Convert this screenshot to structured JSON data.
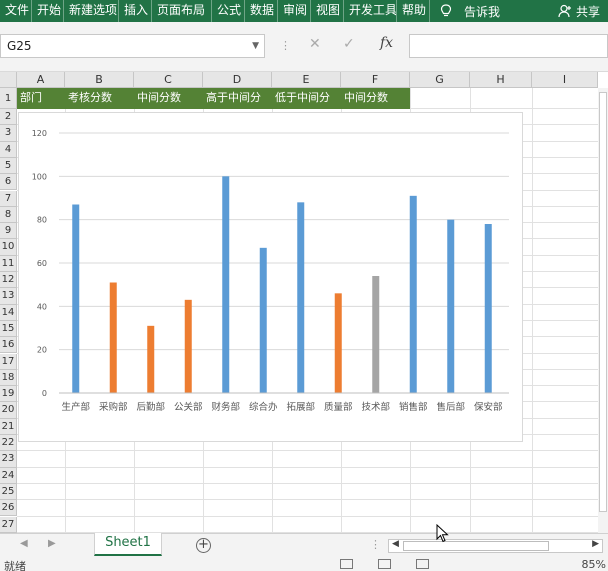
{
  "ribbon": {
    "tabs": [
      "文件",
      "开始",
      "新建选项",
      "插入",
      "页面布局",
      "公式",
      "数据",
      "审阅",
      "视图",
      "开发工具",
      "帮助"
    ],
    "tell_me": "告诉我",
    "share": "共享",
    "bg_color": "#217346"
  },
  "formula_bar": {
    "name_box": "G25",
    "cancel_icon": "✕",
    "enter_icon": "✓",
    "fx_label": "fx",
    "formula": ""
  },
  "grid": {
    "columns": [
      "A",
      "B",
      "C",
      "D",
      "E",
      "F",
      "G",
      "H",
      "I"
    ],
    "rows": [
      "1",
      "2",
      "3",
      "4",
      "5",
      "6",
      "7",
      "8",
      "9",
      "10",
      "11",
      "12",
      "13",
      "14",
      "15",
      "16",
      "17",
      "18",
      "19",
      "20",
      "21",
      "22",
      "23",
      "24",
      "25",
      "26",
      "27"
    ],
    "header_row": [
      "部门",
      "考核分数",
      "中间分数",
      "高于中间分",
      "低于中间分",
      "中间分数"
    ],
    "header_color": "#548235"
  },
  "chart_data": {
    "type": "bar",
    "categories": [
      "生产部",
      "采购部",
      "后勤部",
      "公关部",
      "财务部",
      "综合办",
      "拓展部",
      "质量部",
      "技术部",
      "销售部",
      "售后部",
      "保安部"
    ],
    "series": [
      {
        "name": "高于中间分",
        "color": "#5b9bd5",
        "values": [
          87,
          null,
          null,
          null,
          100,
          67,
          88,
          null,
          null,
          91,
          80,
          78
        ]
      },
      {
        "name": "低于中间分",
        "color": "#ed7d31",
        "values": [
          null,
          51,
          31,
          43,
          null,
          null,
          null,
          46,
          null,
          null,
          null,
          null
        ]
      },
      {
        "name": "中间分数",
        "color": "#a5a5a5",
        "values": [
          null,
          null,
          null,
          null,
          null,
          null,
          null,
          null,
          54,
          null,
          null,
          null
        ]
      }
    ],
    "yticks": [
      0,
      20,
      40,
      60,
      80,
      100,
      120
    ],
    "ylim": [
      0,
      120
    ],
    "title": "",
    "xlabel": "",
    "ylabel": "",
    "grid": true,
    "legend": "none"
  },
  "sheets": {
    "tabs": [
      "Sheet1"
    ],
    "active": "Sheet1"
  },
  "status": {
    "ready": "就绪",
    "zoom": "85%"
  }
}
